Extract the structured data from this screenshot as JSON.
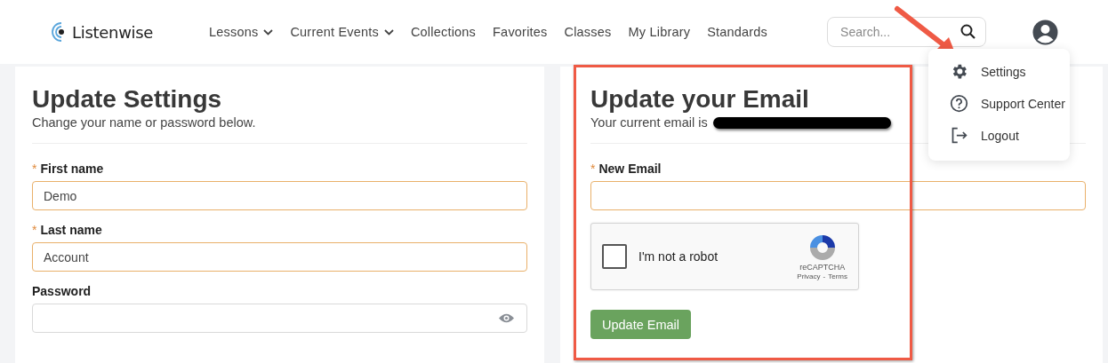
{
  "logo": {
    "text": "Listenwise"
  },
  "nav": [
    {
      "label": "Lessons",
      "has_menu": true
    },
    {
      "label": "Current Events",
      "has_menu": true
    },
    {
      "label": "Collections",
      "has_menu": false
    },
    {
      "label": "Favorites",
      "has_menu": false
    },
    {
      "label": "Classes",
      "has_menu": false
    },
    {
      "label": "My Library",
      "has_menu": false
    },
    {
      "label": "Standards",
      "has_menu": false
    }
  ],
  "search": {
    "placeholder": "Search..."
  },
  "user_menu": {
    "expanded": true,
    "items": [
      {
        "label": "Settings",
        "kind": "settings"
      },
      {
        "label": "Support Center",
        "kind": "help"
      },
      {
        "label": "Logout",
        "kind": "logout"
      }
    ]
  },
  "settings_card": {
    "title": "Update Settings",
    "subtitle": "Change your name or password below.",
    "fields": [
      {
        "label": "First name",
        "required_mark": "*",
        "value": "Demo",
        "kind": "text"
      },
      {
        "label": "Last name",
        "required_mark": "*",
        "value": "Account",
        "kind": "text"
      },
      {
        "label": "Password",
        "kind": "password"
      }
    ]
  },
  "email_card": {
    "title": "Update your Email",
    "subtitle": "Your current email is",
    "email_redacted": true,
    "fields": [
      {
        "label": "New Email",
        "required_mark": "*"
      }
    ],
    "captcha": {
      "label": "I'm not a robot",
      "checked": false,
      "brand": "reCAPTCHA",
      "privacy": "Privacy",
      "separator": "-",
      "terms": "Terms"
    },
    "button": "Update Email"
  },
  "annotations": {
    "highlight_box": true,
    "arrow": true
  }
}
